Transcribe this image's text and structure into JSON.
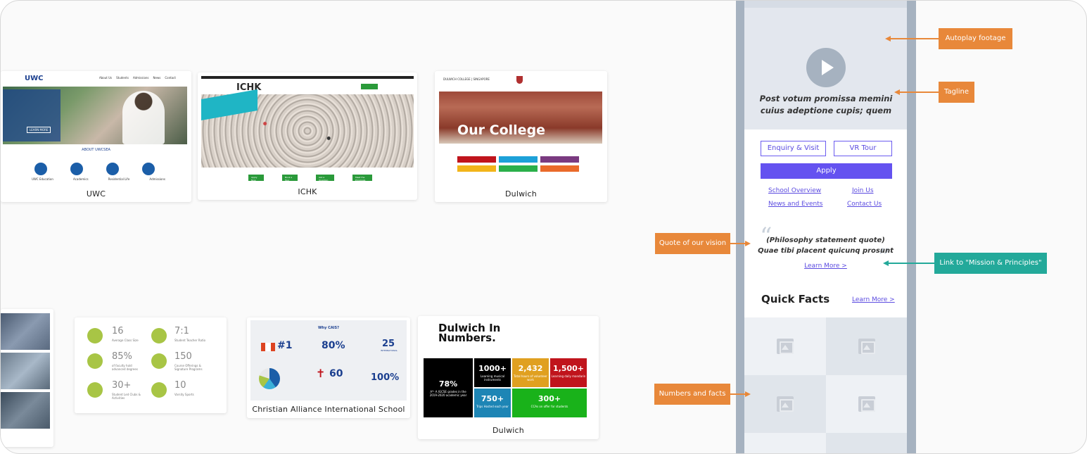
{
  "captions": {
    "uwc": "UWC",
    "ichk": "ICHK",
    "dulwich": "Dulwich",
    "cais": "Christian Alliance International School",
    "dulwich2": "Dulwich"
  },
  "uwc": {
    "about": "ABOUT UWCSEA",
    "logo": "UWC",
    "nav": [
      "About Us",
      "Students",
      "Admissions",
      "News",
      "Contact"
    ],
    "cta": "LEARN MORE",
    "icons": [
      "UWC Education",
      "Academics",
      "Residential Life",
      "Admissions"
    ]
  },
  "ichk": {
    "logo": "ICHK",
    "buttons": [
      "Apply Now",
      "Book a Tour",
      "Ask a Question",
      "Meet the Principals"
    ]
  },
  "dulwich": {
    "brand": "DULWICH COLLEGE | SINGAPORE",
    "hero": "Our College"
  },
  "facts": [
    {
      "num": "16",
      "label": "Average Class Size"
    },
    {
      "num": "7:1",
      "label": "Student Teacher Ratio"
    },
    {
      "num": "85%",
      "label": "of faculty hold advanced degrees"
    },
    {
      "num": "150",
      "label": "Course Offerings & Signature Programs"
    },
    {
      "num": "30+",
      "label": "Student Led Clubs & Activities"
    },
    {
      "num": "10",
      "label": "Varsity Sports"
    }
  ],
  "cais": {
    "title": "Why CAIS?",
    "stats": [
      "#1",
      "80%",
      "25",
      "60",
      "100%"
    ],
    "stat_sub": "INTERNATIONAL"
  },
  "dnum": {
    "title_line1": "Dulwich In",
    "title_line2": "Numbers.",
    "big": "78%",
    "big_sub": "A*- A IGCSE grades in the 2019-2020 academic year",
    "tiles": [
      {
        "n": "1000+",
        "l": "Learning musical instruments",
        "color": "#000000"
      },
      {
        "n": "2,432",
        "l": "Total hours of volunteer work",
        "color": "#e0a020"
      },
      {
        "n": "1,500+",
        "l": "Learning daily mandarin",
        "color": "#c0141c"
      },
      {
        "n": "750+",
        "l": "Trips Hosted each year",
        "color": "#1d85b5"
      },
      {
        "n": "300+",
        "l": "CCAs on offer for students",
        "color": "#19b21a"
      }
    ]
  },
  "mock": {
    "tagline": "Post votum promissa memini cuius adeptione cupis; quem",
    "enquiry": "Enquiry & Visit",
    "vrtour": "VR Tour",
    "apply": "Apply",
    "links": [
      "School Overview",
      "Join Us",
      "News and Events",
      "Contact Us"
    ],
    "quote_line1": "(Philosophy statement quote)",
    "quote_line2": "Quae tibi placent quicunq prosunt",
    "learn_more": "Learn More >",
    "quick_facts": "Quick Facts",
    "qf_learn_more": "Learn More >"
  },
  "callouts": {
    "autoplay": "Autoplay footage",
    "tagline": "Tagline",
    "quote": "Quote of our vision",
    "mission": "Link to \"Mission & Principles\"",
    "numbers": "Numbers and facts"
  },
  "colors": {
    "accent": "#6452f0",
    "orange": "#e8883a",
    "teal": "#23a99a",
    "mockbar": "#a6b2c0"
  }
}
